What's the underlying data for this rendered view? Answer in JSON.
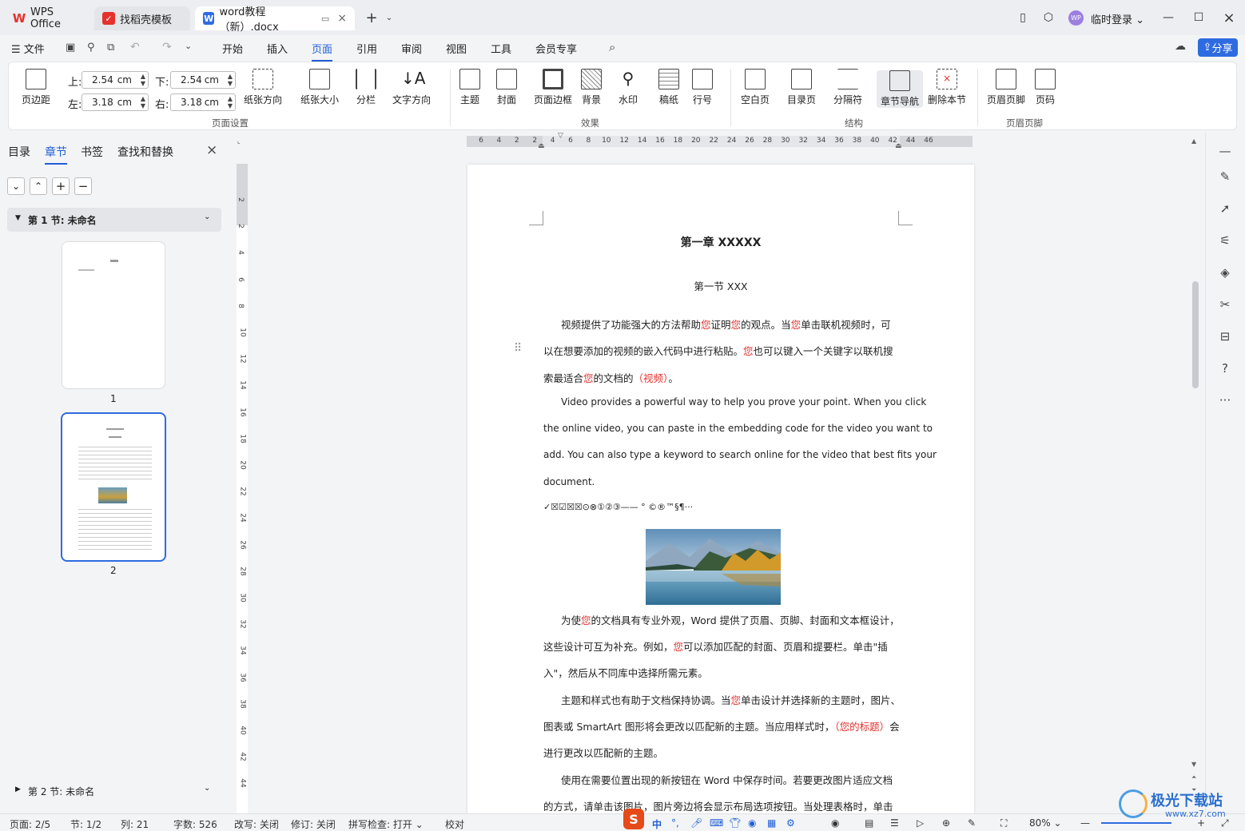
{
  "titlebar": {
    "tabs": [
      {
        "label": "WPS Office",
        "icon": "wps-logo-icon"
      },
      {
        "label": "找稻壳模板",
        "icon": "docer-icon"
      },
      {
        "label": "word教程（新）.docx",
        "icon": "word-doc-icon"
      }
    ],
    "user_label": "临时登录",
    "avatar_text": "WP"
  },
  "menubar": {
    "file": "文件",
    "items": [
      "开始",
      "插入",
      "页面",
      "引用",
      "审阅",
      "视图",
      "工具",
      "会员专享"
    ],
    "active": "页面",
    "share": "分享"
  },
  "ribbon": {
    "margin_button": "页边距",
    "top_label": "上:",
    "top_value": "2.54",
    "bottom_label": "下:",
    "bottom_value": "2.54",
    "left_label": "左:",
    "left_value": "3.18",
    "right_label": "右:",
    "right_value": "3.18",
    "unit": "cm",
    "orientation": "纸张方向",
    "size": "纸张大小",
    "columns": "分栏",
    "text_direction": "文字方向",
    "group_page_setup": "页面设置",
    "theme": "主题",
    "cover": "封面",
    "page_border": "页面边框",
    "background": "背景",
    "watermark": "水印",
    "manuscript": "稿纸",
    "line_number": "行号",
    "group_effect": "效果",
    "blank_page": "空白页",
    "toc_page": "目录页",
    "separator": "分隔符",
    "section_nav": "章节导航",
    "delete_section": "删除本节",
    "group_structure": "结构",
    "header_footer": "页眉页脚",
    "page_number": "页码",
    "group_header_footer": "页眉页脚"
  },
  "leftpanel": {
    "tabs": [
      "目录",
      "章节",
      "书签",
      "查找和替换"
    ],
    "active_tab": "章节",
    "section1": "第 1 节: 未命名",
    "section2": "第 2 节: 未命名",
    "thumb1_label": "1",
    "thumb2_label": "2"
  },
  "ruler": {
    "h_ticks": [
      "6",
      "4",
      "2",
      "2",
      "4",
      "6",
      "8",
      "10",
      "12",
      "14",
      "16",
      "18",
      "20",
      "22",
      "24",
      "26",
      "28",
      "30",
      "32",
      "34",
      "36",
      "38",
      "40",
      "42",
      "44",
      "46"
    ],
    "v_ticks": [
      "2",
      "2",
      "4",
      "6",
      "8",
      "10",
      "12",
      "14",
      "16",
      "18",
      "20",
      "22",
      "24",
      "26",
      "28",
      "30",
      "32",
      "34",
      "36",
      "38",
      "40",
      "42",
      "44"
    ]
  },
  "document": {
    "chapter_title": "第一章  XXXXX",
    "section_title": "第一节  XXX",
    "para1_line1": [
      "视频提供了功能强大的方法帮助",
      "您",
      "证明",
      "您",
      "的观点。当",
      "您",
      "单击联机视频时，可"
    ],
    "para1_line2": [
      "以在想要添加的视频的嵌入代码中进行粘贴。",
      "您",
      "也可以键入一个关键字以联机搜"
    ],
    "para1_line3": [
      "索最适合",
      "您",
      "的文档的",
      "（视频）",
      "。"
    ],
    "para2_line1": "Video provides a powerful way to help you prove your point. When you click",
    "para2_line2": "the online video, you can paste in the embedding code for the video you want to",
    "para2_line3": "add. You can also type a keyword to search online for the video that best fits your",
    "para2_line4": "document.",
    "symbols_line": "✓☒☑☒☒⊙⊗①②③——    °  ©®™§¶···",
    "para3_line1": [
      "为使",
      "您",
      "的文档具有专业外观，Word  提供了页眉、页脚、封面和文本框设计，"
    ],
    "para3_line2": [
      "这些设计可互为补充。例如，",
      "您",
      "可以添加匹配的封面、页眉和提要栏。单击\"插"
    ],
    "para3_line3": "入\"，然后从不同库中选择所需元素。",
    "para4_line1": [
      "主题和样式也有助于文档保持协调。当",
      "您",
      "单击设计并选择新的主题时，图片、"
    ],
    "para4_line2": [
      "图表或  SmartArt  图形将会更改以匹配新的主题。当应用样式时，",
      "（您的标题）",
      "会"
    ],
    "para4_line3": "进行更改以匹配新的主题。",
    "para5_line1": "使用在需要位置出现的新按钮在  Word  中保存时间。若要更改图片适应文档",
    "para5_line2": "的方式，请单击该图片，图片旁边将会显示布局选项按钮。当处理表格时，单击"
  },
  "statusbar": {
    "page": "页面: 2/5",
    "section": "节: 1/2",
    "column": "列: 21",
    "words": "字数: 526",
    "revise_mode": "改写: 关闭",
    "track": "修订: 关闭",
    "spell": "拼写检查: 打开",
    "proof": "校对",
    "zoom": "80%",
    "ime": "中"
  },
  "watermark": {
    "site_name": "极光下载站",
    "site_url": "www.xz7.com"
  },
  "colors": {
    "accent": "#1f5fd6",
    "red_text": "#e0322f",
    "wps_red": "#e5312c"
  }
}
